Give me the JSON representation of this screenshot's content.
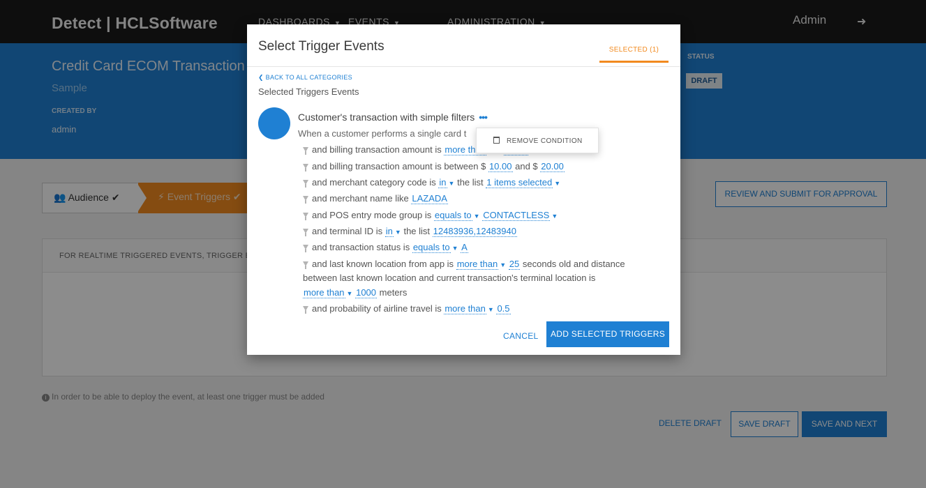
{
  "nav": {
    "brand": "Detect | HCLSoftware",
    "items": [
      "DASHBOARDS",
      "EVENTS",
      "ADMINISTRATION"
    ],
    "user": "Admin"
  },
  "banner": {
    "title": "Credit Card ECOM Transaction",
    "subtitle": "Sample",
    "created_by_label": "CREATED BY",
    "created_by": "admin",
    "status_label": "STATUS",
    "status": "DRAFT"
  },
  "wizard": {
    "audience": "Audience",
    "events": "Event Triggers",
    "review_button": "REVIEW AND SUBMIT FOR APPROVAL"
  },
  "panel": {
    "header": "FOR REALTIME TRIGGERED EVENTS, TRIGGER E"
  },
  "hint": "In order to be able to deploy the event, at least one trigger must be added",
  "footer": {
    "delete": "DELETE DRAFT",
    "save": "SAVE DRAFT",
    "next": "SAVE AND NEXT"
  },
  "modal": {
    "title": "Select Trigger Events",
    "tab_selected": "SELECTED (1)",
    "back": "BACK TO ALL CATEGORIES",
    "heading": "Selected Triggers Events",
    "trigger_name": "Customer's transaction with simple filters",
    "trigger_desc": "When a customer performs a single card t",
    "conditions": {
      "c1": {
        "text": "and billing transaction amount is",
        "v1": "more than",
        "t2": "$",
        "v2": "20.00"
      },
      "c2": {
        "text": "and billing transaction amount is between $",
        "v1": "10.00",
        "t2": "and $",
        "v2": "20.00"
      },
      "c3": {
        "text": "and merchant category code is",
        "v1": "in",
        "t2": "the list",
        "v2": "1 items selected"
      },
      "c4": {
        "text": "and merchant name like",
        "v1": "LAZADA"
      },
      "c5": {
        "text": "and POS entry mode group is",
        "v1": "equals to",
        "v2": "CONTACTLESS"
      },
      "c6": {
        "text": "and terminal ID is",
        "v1": "in",
        "t2": "the list",
        "v2": "12483936,12483940"
      },
      "c7": {
        "text": "and transaction status is",
        "v1": "equals to",
        "v2": "A"
      },
      "c8": {
        "text": "and last known location from app is",
        "v1": "more than",
        "v2": "25",
        "t2": "seconds old and distance",
        "line2": "between last known location and current transaction's terminal location is",
        "v3": "more than",
        "v4": "1000",
        "t3": "meters"
      },
      "c9": {
        "text": "and probability of airline travel is",
        "v1": "more than",
        "v2": "0.5"
      }
    },
    "cancel": "CANCEL",
    "add": "ADD SELECTED TRIGGERS",
    "remove_condition": "REMOVE CONDITION"
  },
  "colors": {
    "primary": "#1f80d3",
    "accent": "#f28a1f",
    "topbar": "#1a1a1a"
  }
}
